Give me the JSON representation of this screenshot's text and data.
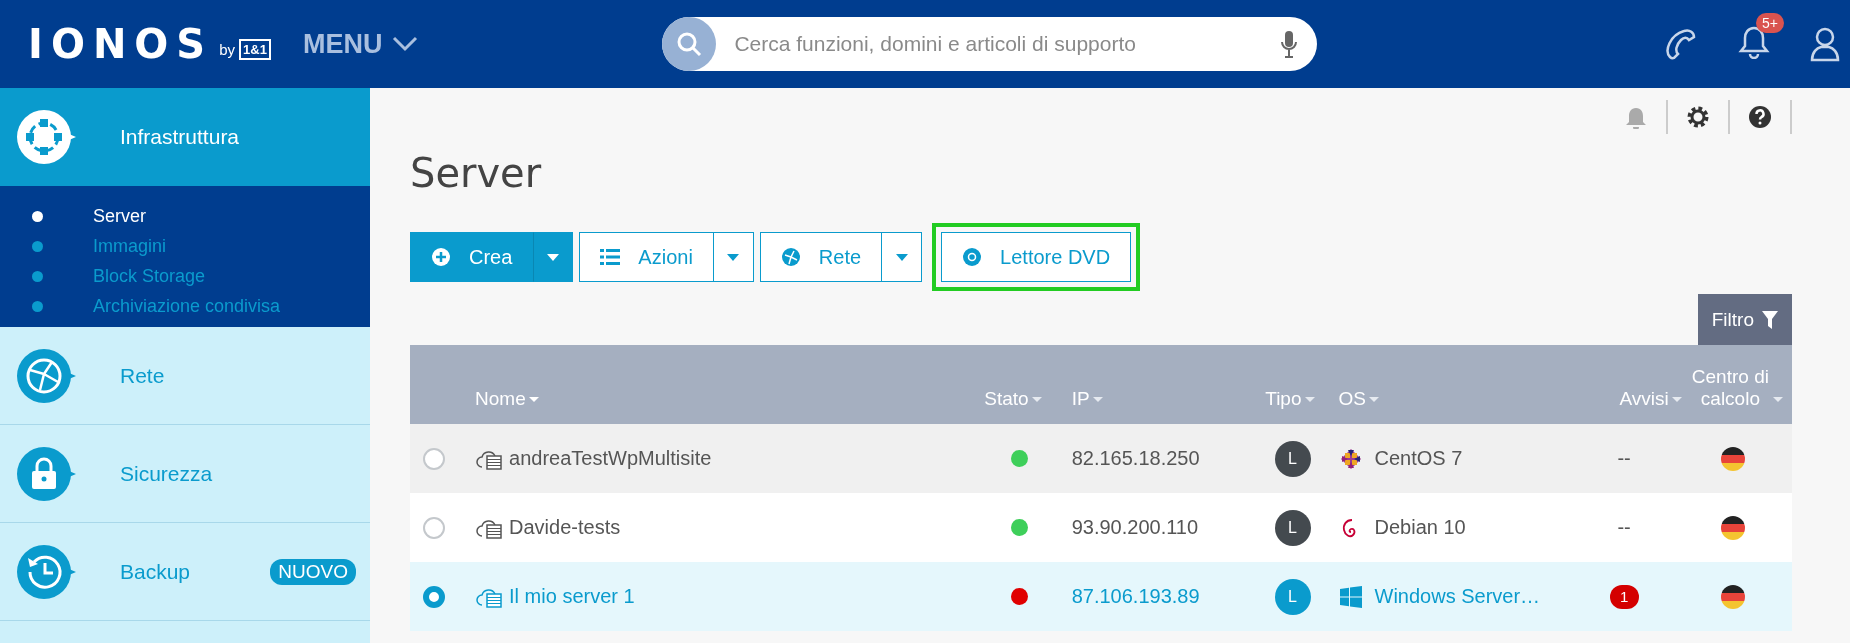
{
  "header": {
    "logo": "IONOS",
    "logo_by": "by",
    "logo_brand": "1&1",
    "menu": "MENU",
    "search": {
      "placeholder": "Cerca funzioni, domini e articoli di supporto"
    },
    "notifications_badge": "5+"
  },
  "sidebar": {
    "items": [
      {
        "kind": "infrastructure",
        "label": "Infrastruttura",
        "selected": true,
        "children": [
          {
            "label": "Server",
            "selected": true
          },
          {
            "label": "Immagini",
            "selected": false
          },
          {
            "label": "Block Storage",
            "selected": false
          },
          {
            "label": "Archiviazione condivisa",
            "selected": false
          }
        ]
      },
      {
        "kind": "network",
        "label": "Rete",
        "selected": false
      },
      {
        "kind": "security",
        "label": "Sicurezza",
        "selected": false
      },
      {
        "kind": "backup",
        "label": "Backup",
        "selected": false,
        "badge": "NUOVO"
      }
    ]
  },
  "page": {
    "title": "Server"
  },
  "toolbar": [
    {
      "kind": "create",
      "label": "Crea",
      "primary": true,
      "dropdown": true,
      "highlighted": false
    },
    {
      "kind": "actions",
      "label": "Azioni",
      "primary": false,
      "dropdown": true,
      "highlighted": false
    },
    {
      "kind": "network",
      "label": "Rete",
      "primary": false,
      "dropdown": true,
      "highlighted": false
    },
    {
      "kind": "dvd",
      "label": "Lettore DVD",
      "primary": false,
      "dropdown": false,
      "highlighted": true
    }
  ],
  "filter_button": "Filtro",
  "table": {
    "columns": [
      {
        "label": "Nome"
      },
      {
        "label": "Stato"
      },
      {
        "label": "IP"
      },
      {
        "label": "Tipo"
      },
      {
        "label": "OS"
      },
      {
        "label": "Avvisi"
      },
      {
        "label": "Centro di calcolo"
      }
    ],
    "rows": [
      {
        "selected": false,
        "name": "andreaTestWpMultisite",
        "status": {
          "color": "#3ecf5a"
        },
        "ip": "82.165.18.250",
        "type": "L",
        "os": {
          "kind": "centos",
          "label": "CentOS 7"
        },
        "alerts": {
          "kind": "text",
          "label": "--"
        }
      },
      {
        "selected": false,
        "name": "Davide-tests",
        "status": {
          "color": "#3ecf5a"
        },
        "ip": "93.90.200.110",
        "type": "L",
        "os": {
          "kind": "debian",
          "label": "Debian 10"
        },
        "alerts": {
          "kind": "text",
          "label": "--"
        }
      },
      {
        "selected": true,
        "name": "Il mio server 1",
        "status": {
          "color": "#e00000"
        },
        "ip": "87.106.193.89",
        "type": "L",
        "os": {
          "kind": "windows",
          "label": "Windows Server…"
        },
        "alerts": {
          "kind": "badge",
          "label": "1"
        }
      }
    ]
  }
}
